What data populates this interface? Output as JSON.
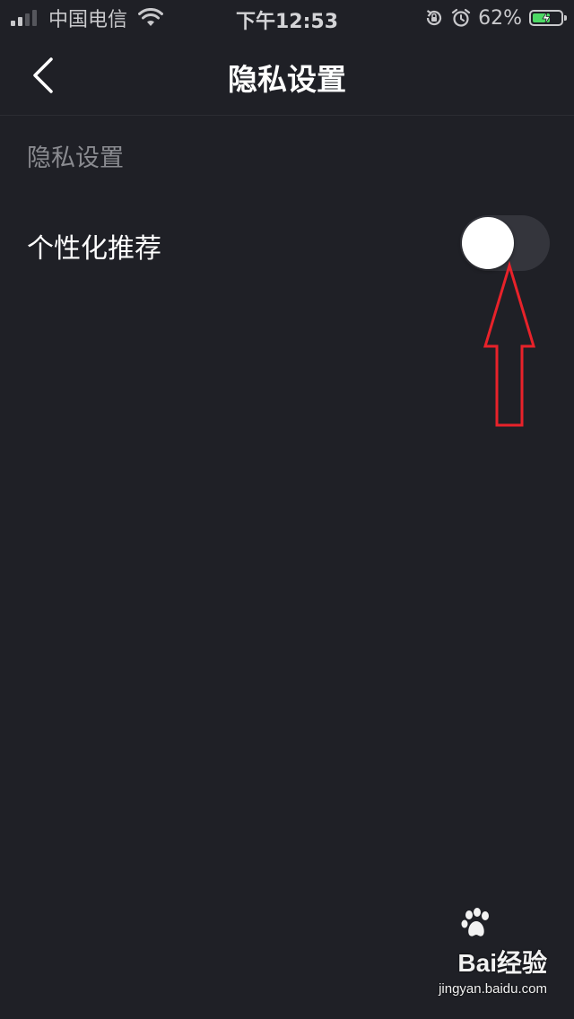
{
  "status_bar": {
    "carrier": "中国电信",
    "time": "下午12:53",
    "battery_percent": "62%",
    "battery_level": 0.62,
    "icons": [
      "signal-icon",
      "wifi-icon",
      "rotation-lock-icon",
      "alarm-icon",
      "battery-charging-icon"
    ]
  },
  "nav": {
    "title": "隐私设置",
    "back_icon": "chevron-left-icon"
  },
  "section": {
    "header": "隐私设置"
  },
  "settings": [
    {
      "label": "个性化推荐",
      "toggle_on": false
    }
  ],
  "annotation": {
    "type": "arrow-up",
    "color": "#e8222a"
  },
  "watermark": {
    "logo_text": "Bai经验",
    "url": "jingyan.baidu.com"
  },
  "colors": {
    "background": "#1f2026",
    "toggle_off_track": "#34353c",
    "secondary_text": "#8a8b90",
    "battery_green": "#4cd964"
  }
}
